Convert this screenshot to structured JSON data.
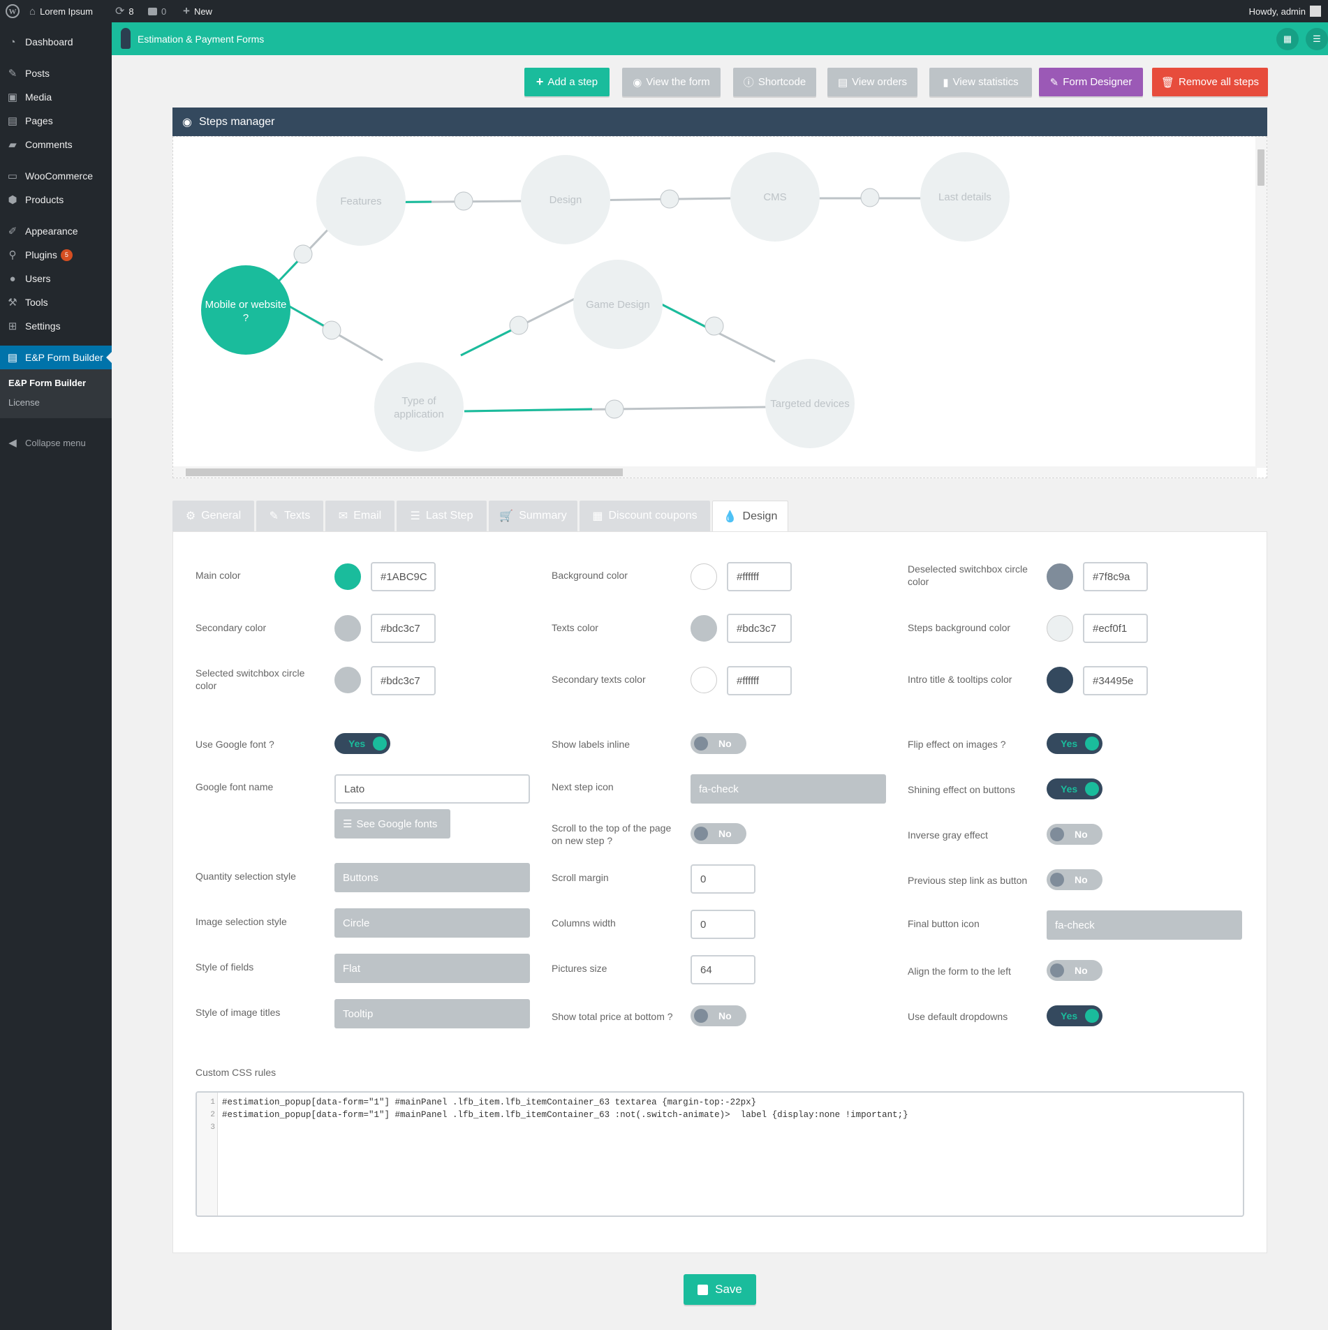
{
  "adminbar": {
    "site_name": "Lorem Ipsum",
    "updates_count": "8",
    "comments_count": "0",
    "new_label": "New",
    "howdy": "Howdy, admin"
  },
  "sidebar": {
    "items": [
      {
        "label": "Dashboard",
        "icon": "dashboard-icon"
      },
      {
        "label": "Posts",
        "icon": "pin-icon"
      },
      {
        "label": "Media",
        "icon": "media-icon"
      },
      {
        "label": "Pages",
        "icon": "page-icon"
      },
      {
        "label": "Comments",
        "icon": "comment-icon"
      },
      {
        "label": "WooCommerce",
        "icon": "woo-icon"
      },
      {
        "label": "Products",
        "icon": "box-icon"
      },
      {
        "label": "Appearance",
        "icon": "brush-icon"
      },
      {
        "label": "Plugins",
        "icon": "plug-icon",
        "badge": "5"
      },
      {
        "label": "Users",
        "icon": "user-icon"
      },
      {
        "label": "Tools",
        "icon": "wrench-icon"
      },
      {
        "label": "Settings",
        "icon": "settings-icon"
      },
      {
        "label": "E&P Form Builder",
        "icon": "form-icon"
      }
    ],
    "submenu": [
      "E&P Form Builder",
      "License"
    ],
    "collapse": "Collapse menu"
  },
  "app": {
    "title": "Estimation & Payment Forms"
  },
  "actions": [
    {
      "label": "Add a step",
      "color": "#1abc9c"
    },
    {
      "label": "View the form",
      "color": "#bdc3c7"
    },
    {
      "label": "Shortcode",
      "color": "#bdc3c7"
    },
    {
      "label": "View orders",
      "color": "#bdc3c7"
    },
    {
      "label": "View statistics",
      "color": "#bdc3c7"
    },
    {
      "label": "Form Designer",
      "color": "#9b59b6"
    },
    {
      "label": "Remove all steps",
      "color": "#e74c3c"
    }
  ],
  "steps_manager": {
    "title": "Steps manager",
    "nodes": {
      "mobile": [
        "Mobile or website",
        "?"
      ],
      "features": "Features",
      "design": "Design",
      "cms": "CMS",
      "last": "Last details",
      "game": "Game Design",
      "type": [
        "Type of",
        "application"
      ],
      "targeted": "Targeted devices"
    }
  },
  "tabs": [
    "General",
    "Texts",
    "Email",
    "Last Step",
    "Summary",
    "Discount coupons",
    "Design"
  ],
  "design": {
    "colors": [
      {
        "label": "Main color",
        "value": "#1ABC9C"
      },
      {
        "label": "Background color",
        "value": "#ffffff"
      },
      {
        "label": "Deselected switchbox circle color",
        "value": "#7f8c9a"
      },
      {
        "label": "Secondary color",
        "value": "#bdc3c7"
      },
      {
        "label": "Texts color",
        "value": "#bdc3c7"
      },
      {
        "label": "Steps background color",
        "value": "#ecf0f1"
      },
      {
        "label": "Selected switchbox circle color",
        "value": "#bdc3c7"
      },
      {
        "label": "Secondary texts color",
        "value": "#ffffff"
      },
      {
        "label": "Intro title & tooltips color",
        "value": "#34495e"
      }
    ],
    "col1": {
      "google_font_label": "Use Google font ?",
      "google_font_value": "Yes",
      "font_name_label": "Google font name",
      "font_name_value": "Lato",
      "see_fonts": "See Google fonts",
      "qty_label": "Quantity selection style",
      "qty_value": "Buttons",
      "img_label": "Image selection style",
      "img_value": "Circle",
      "fields_label": "Style of fields",
      "fields_value": "Flat",
      "imgtitles_label": "Style of image titles",
      "imgtitles_value": "Tooltip"
    },
    "col2": {
      "inline_label": "Show labels inline",
      "inline_value": "No",
      "nexticon_label": "Next step icon",
      "nexticon_value": "fa-check",
      "scroll_label": "Scroll to the top of the page on new step ?",
      "scroll_value": "No",
      "margin_label": "Scroll margin",
      "margin_value": "0",
      "colwidth_label": "Columns width",
      "colwidth_value": "0",
      "pics_label": "Pictures size",
      "pics_value": "64",
      "total_label": "Show total price at bottom ?",
      "total_value": "No"
    },
    "col3": {
      "flip_label": "Flip effect on images ?",
      "flip_value": "Yes",
      "shine_label": "Shining effect on buttons",
      "shine_value": "Yes",
      "gray_label": "Inverse gray effect",
      "gray_value": "No",
      "prev_label": "Previous step link as button",
      "prev_value": "No",
      "finalicon_label": "Final button icon",
      "finalicon_value": "fa-check",
      "align_label": "Align the form to the left",
      "align_value": "No",
      "dropdown_label": "Use default dropdowns",
      "dropdown_value": "Yes"
    },
    "css_label": "Custom CSS rules",
    "css_lines": [
      "#estimation_popup[data-form=\"1\"] #mainPanel .lfb_item.lfb_itemContainer_63 textarea {margin-top:-22px}",
      "#estimation_popup[data-form=\"1\"] #mainPanel .lfb_item.lfb_itemContainer_63 :not(.switch-animate)>  label {display:none !important;}",
      ""
    ],
    "line_numbers": [
      "1",
      "2",
      "3"
    ]
  },
  "save_label": "Save"
}
